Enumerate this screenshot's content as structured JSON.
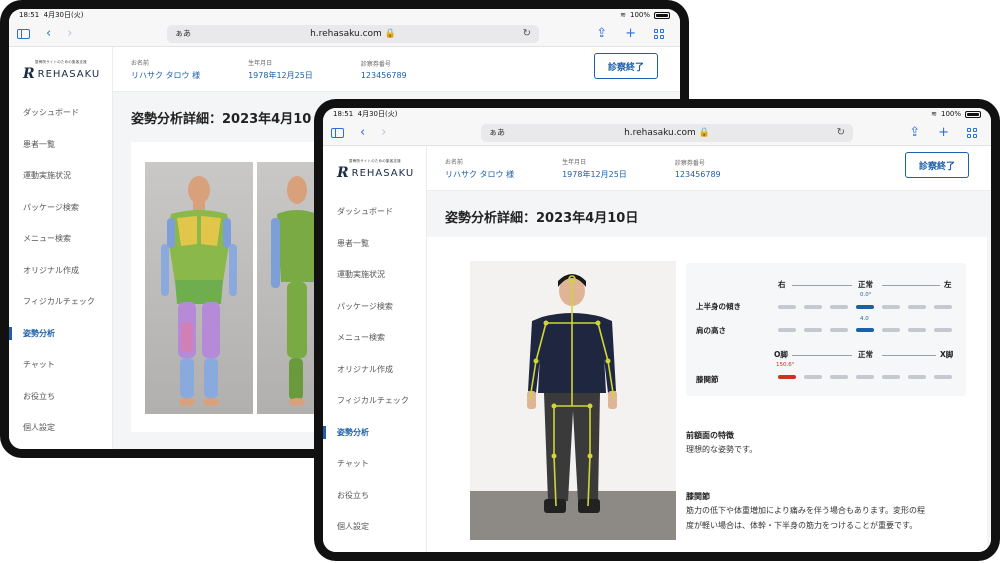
{
  "browser": {
    "status_time": "18:51",
    "status_date": "4月30日(火)",
    "battery": "100%",
    "aa": "ぁあ",
    "url": "h.rehasaku.com 🔒"
  },
  "logo": {
    "tagline": "整骨院サイトのための集客支援",
    "name": "REHASAKU"
  },
  "nav": [
    "ダッシュボード",
    "患者一覧",
    "運動実施状況",
    "パッケージ検索",
    "メニュー検索",
    "オリジナル作成",
    "フィジカルチェック",
    "姿勢分析",
    "チャット",
    "お役立ち",
    "個人設定"
  ],
  "patient": {
    "name_label": "お名前",
    "name": "リハサク タロウ 様",
    "dob_label": "生年月日",
    "dob": "1978年12月25日",
    "card_label": "診察券番号",
    "card_no": "123456789"
  },
  "end_button": "診察終了",
  "page_title": "姿勢分析詳細：2023年4月10日",
  "back_page_title": "姿勢分析詳細：2023年4月10",
  "analysis": {
    "row1_left": "右",
    "row1_center": "正常",
    "row1_right": "左",
    "upper_label": "上半身の傾き",
    "upper_value": "0.0°",
    "shoulder_label": "肩の高さ",
    "shoulder_value": "4.0",
    "row2_left": "O脚",
    "row2_center": "正常",
    "row2_right": "X脚",
    "knee_label": "膝関節",
    "knee_value": "150.6°"
  },
  "features": {
    "front_title": "前額面の特徴",
    "front_text": "理想的な姿勢です。",
    "knee_title": "膝関節",
    "knee_text_1": "筋力の低下や体重増加により痛みを伴う場合もあります。変形の程",
    "knee_text_2": "度が軽い場合は、体幹・下半身の筋力をつけることが重要です。"
  },
  "colors": {
    "accent": "#1d5fa8",
    "warning": "#d0311e"
  }
}
